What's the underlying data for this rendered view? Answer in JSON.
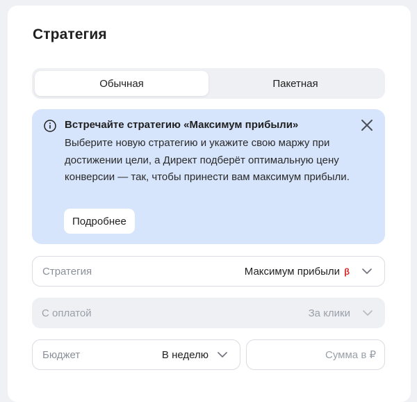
{
  "title": "Стратегия",
  "tabs": [
    {
      "label": "Обычная",
      "active": true
    },
    {
      "label": "Пакетная",
      "active": false
    }
  ],
  "banner": {
    "title": "Встречайте стратегию «Максимум прибыли»",
    "text": "Выберите новую стратегию и укажите свою маржу при достижении цели, а Директ подберёт оптимальную цену конверсии — так, чтобы принести вам максимум прибыли.",
    "more_label": "Подробнее",
    "icon": "info-icon",
    "close_icon": "close-icon"
  },
  "fields": {
    "strategy": {
      "label": "Стратегия",
      "value": "Максимум прибыли",
      "badge": "β"
    },
    "payment": {
      "label": "С оплатой",
      "value": "За клики"
    },
    "budget": {
      "label": "Бюджет",
      "value": "В неделю"
    },
    "sum": {
      "placeholder": "Сумма в ₽"
    }
  },
  "colors": {
    "banner_bg": "#d6e5fc",
    "beta_badge": "#d93030"
  }
}
